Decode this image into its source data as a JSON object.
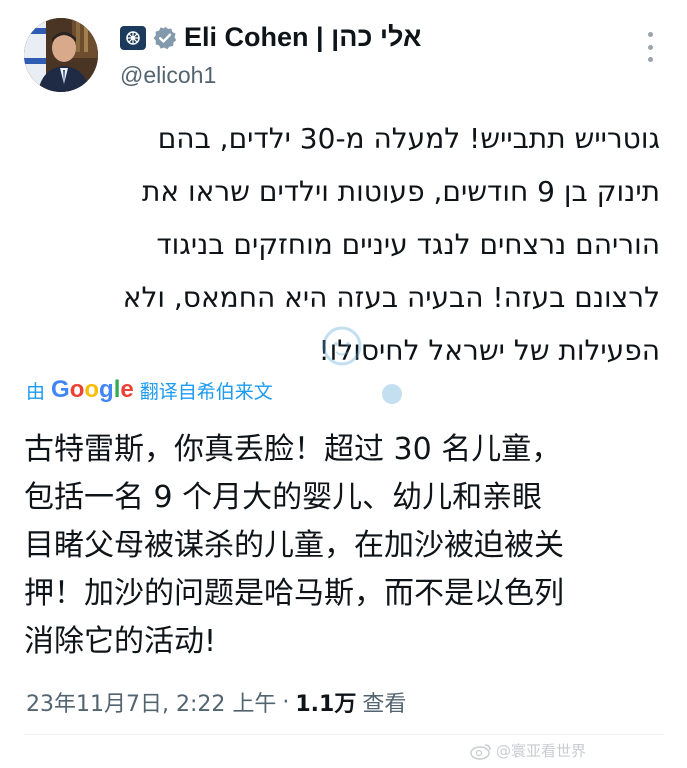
{
  "author": {
    "display_name": "Eli Cohen | אלי כהן",
    "handle": "@elicoh1"
  },
  "tweet": {
    "hebrew_lines": [
      "גוטרייש תתבייש! למעלה מ-30 ילדים, בהם",
      "תינוק בן 9 חודשים, פעוטות וילדים שראו את",
      "הוריהם נרצחים לנגד עיניים מוחזקים בניגוד",
      "לרצונם בעזה! הבעיה בעזה היא החמאס, ולא",
      "הפעילות של ישראל לחיסולו!"
    ],
    "translation": {
      "prefix": "由",
      "provider": "Google",
      "suffix": "翻译自希伯来文"
    },
    "chinese_lines": [
      "古特雷斯，你真丢脸！超过 30 名儿童，",
      "包括一名 9 个月大的婴儿、幼儿和亲眼",
      "目睹父母被谋杀的儿童，在加沙被迫被关",
      "押！加沙的问题是哈马斯，而不是以色列",
      "消除它的活动!"
    ]
  },
  "meta": {
    "timestamp": "23年11月7日, 2:22 上午",
    "separator": "·",
    "views_count": "1.1万",
    "views_label": "查看"
  },
  "watermarks": {
    "weibo": "@寰亚看世界"
  },
  "icons": {
    "verified": "verified-badge-icon",
    "affiliation": "government-affiliation-icon",
    "more": "more-options-icon"
  }
}
